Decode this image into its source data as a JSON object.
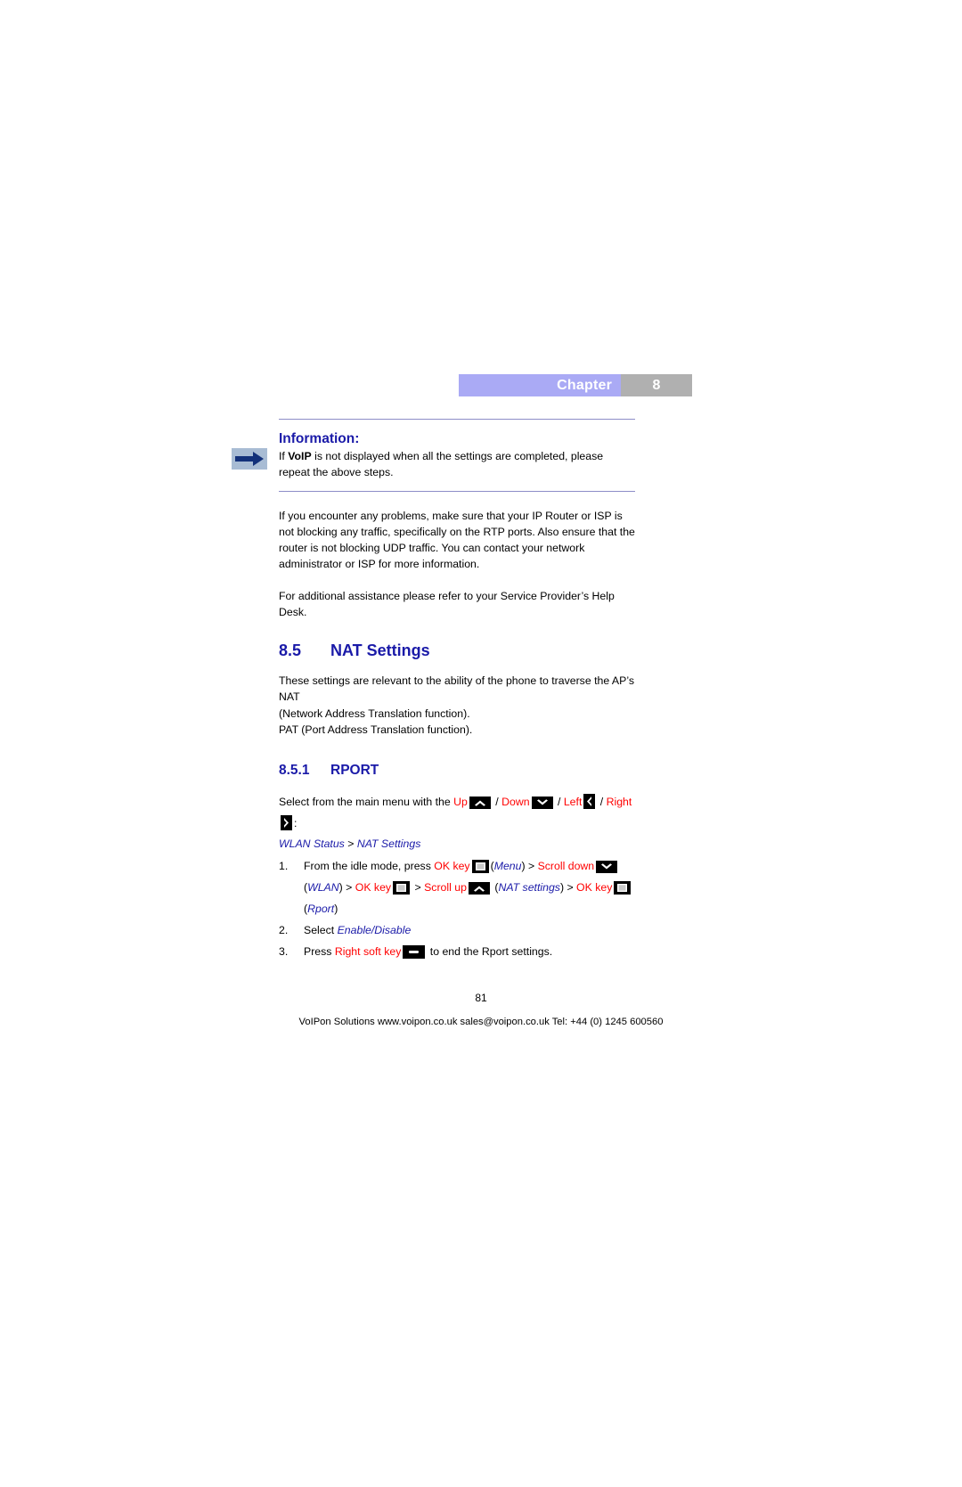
{
  "chapter": {
    "label": "Chapter",
    "number": "8",
    "label_bg": "#aaaaf5",
    "number_bg": "#b0b0b0"
  },
  "information": {
    "icon": "right-arrow-icon",
    "title": "Information:",
    "body_lead": "If ",
    "body_bold": "VoIP",
    "body_rest": " is not displayed when all the settings are completed, please repeat the above steps."
  },
  "paragraphs": {
    "troubleshooting": "If you encounter any problems, make sure that your IP Router or ISP is not blocking any traffic, specifically on the RTP ports. Also ensure that the router is not blocking UDP traffic. You can contact your network administrator or ISP for more information.",
    "assistance": "For additional assistance please refer to your Service Provider’s Help Desk."
  },
  "section": {
    "number": "8.5",
    "title": "NAT Settings",
    "intro_line1": "These settings are relevant to the ability of the phone to traverse the AP’s NAT",
    "intro_line2": "(Network Address Translation function).",
    "intro_line3": "PAT (Port Address Translation function)."
  },
  "subsection": {
    "number": "8.5.1",
    "title": "RPORT"
  },
  "navigation": {
    "lead": "Select from the main menu with the ",
    "up": "Up",
    "up_icon": "chevron-up-icon",
    "sep1": " / ",
    "down": "Down",
    "down_icon": "chevron-down-icon",
    "sep2": " / ",
    "left": "Left",
    "left_icon": "chevron-left-icon",
    "sep3": " / ",
    "right": "Right",
    "right_icon": "chevron-right-icon",
    "trailing": ":",
    "path_part1": "WLAN Status",
    "path_sep": " > ",
    "path_part2": "NAT Settings"
  },
  "steps": [
    {
      "marker": "1.",
      "seg_a": "From the idle mode, press ",
      "key_a_label": "OK key",
      "key_a_icon": "ok-key-icon",
      "seg_b_open": "(",
      "seg_b_italic": "Menu",
      "seg_b_close": ") > ",
      "key_b_label": "Scroll down",
      "key_b_icon": "chevron-down-icon",
      "cont_open": "(",
      "cont_italic_1": "WLAN",
      "cont_mid_1": ") > ",
      "cont_key_1": "OK key",
      "cont_key_1_icon": "ok-key-icon",
      "cont_mid_2": " > ",
      "cont_key_2": "Scroll up",
      "cont_key_2_icon": "chevron-up-icon",
      "cont_open_2": " (",
      "cont_italic_2": "NAT settings",
      "cont_mid_3": ") > ",
      "cont_key_3": "OK key",
      "cont_key_3_icon": "ok-key-icon",
      "cont_line3_open": "(",
      "cont_line3_italic": "Rport",
      "cont_line3_close": ")"
    },
    {
      "marker": "2.",
      "seg_a": "Select ",
      "italic": "Enable/Disable"
    },
    {
      "marker": "3.",
      "seg_a": "Press ",
      "key_label": "Right soft key",
      "key_icon": "right-soft-key-icon",
      "seg_b": " to end the Rport settings."
    }
  ],
  "footer": {
    "page_number": "81",
    "text": "VoIPon Solutions www.voipon.co.uk sales@voipon.co.uk Tel: +44 (0) 1245 600560"
  },
  "colors": {
    "heading_blue": "#1a1aa8",
    "key_red": "#ff0000",
    "rule": "#8d8dc8"
  }
}
